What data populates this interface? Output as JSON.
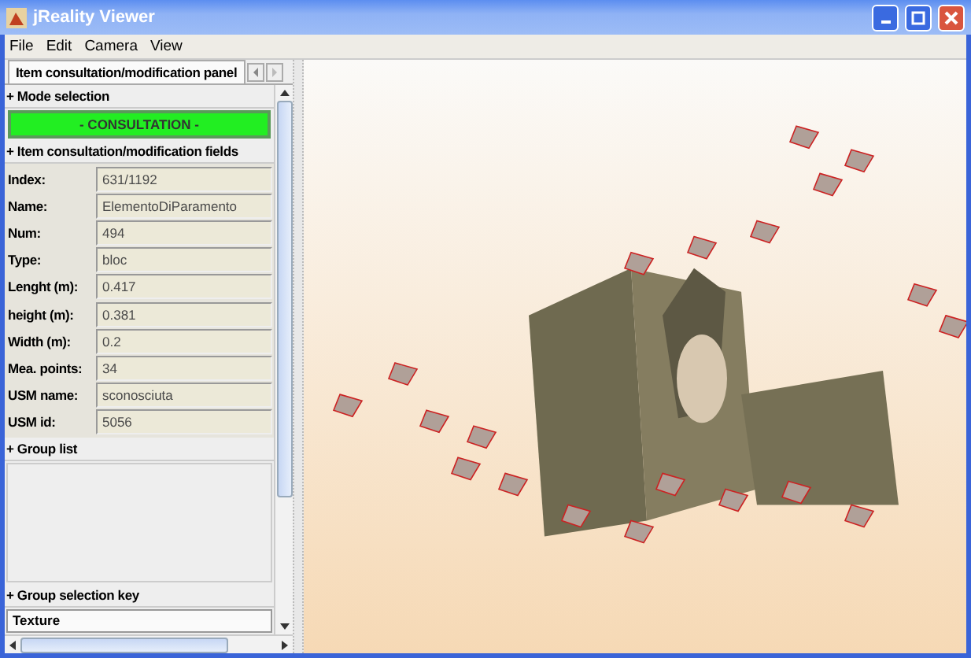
{
  "window": {
    "title": "jReality Viewer"
  },
  "menu": [
    "File",
    "Edit",
    "Camera",
    "View"
  ],
  "tab": {
    "label": "Item consultation/modification panel",
    "selected": true
  },
  "mode_section": {
    "header": "+ Mode selection",
    "mode_button": "- CONSULTATION -"
  },
  "fields_section": {
    "header": "+ Item consultation/modification fields",
    "fields": [
      {
        "label": "Index:",
        "value": "631/1192"
      },
      {
        "label": "Name:",
        "value": "ElementoDiParamento"
      },
      {
        "label": "Num:",
        "value": "494"
      },
      {
        "label": "Type:",
        "value": "bloc"
      },
      {
        "label": "Lenght (m):",
        "value": "0.417"
      },
      {
        "label": "height (m):",
        "value": "0.381"
      },
      {
        "label": "Width (m):",
        "value": "0.2"
      },
      {
        "label": "Mea. points:",
        "value": "34"
      },
      {
        "label": "USM name:",
        "value": "sconosciuta"
      },
      {
        "label": "USM id:",
        "value": "5056"
      }
    ]
  },
  "group_list": {
    "header": "+ Group list"
  },
  "group_key": {
    "header": "+ Group selection key",
    "value": "Texture"
  }
}
